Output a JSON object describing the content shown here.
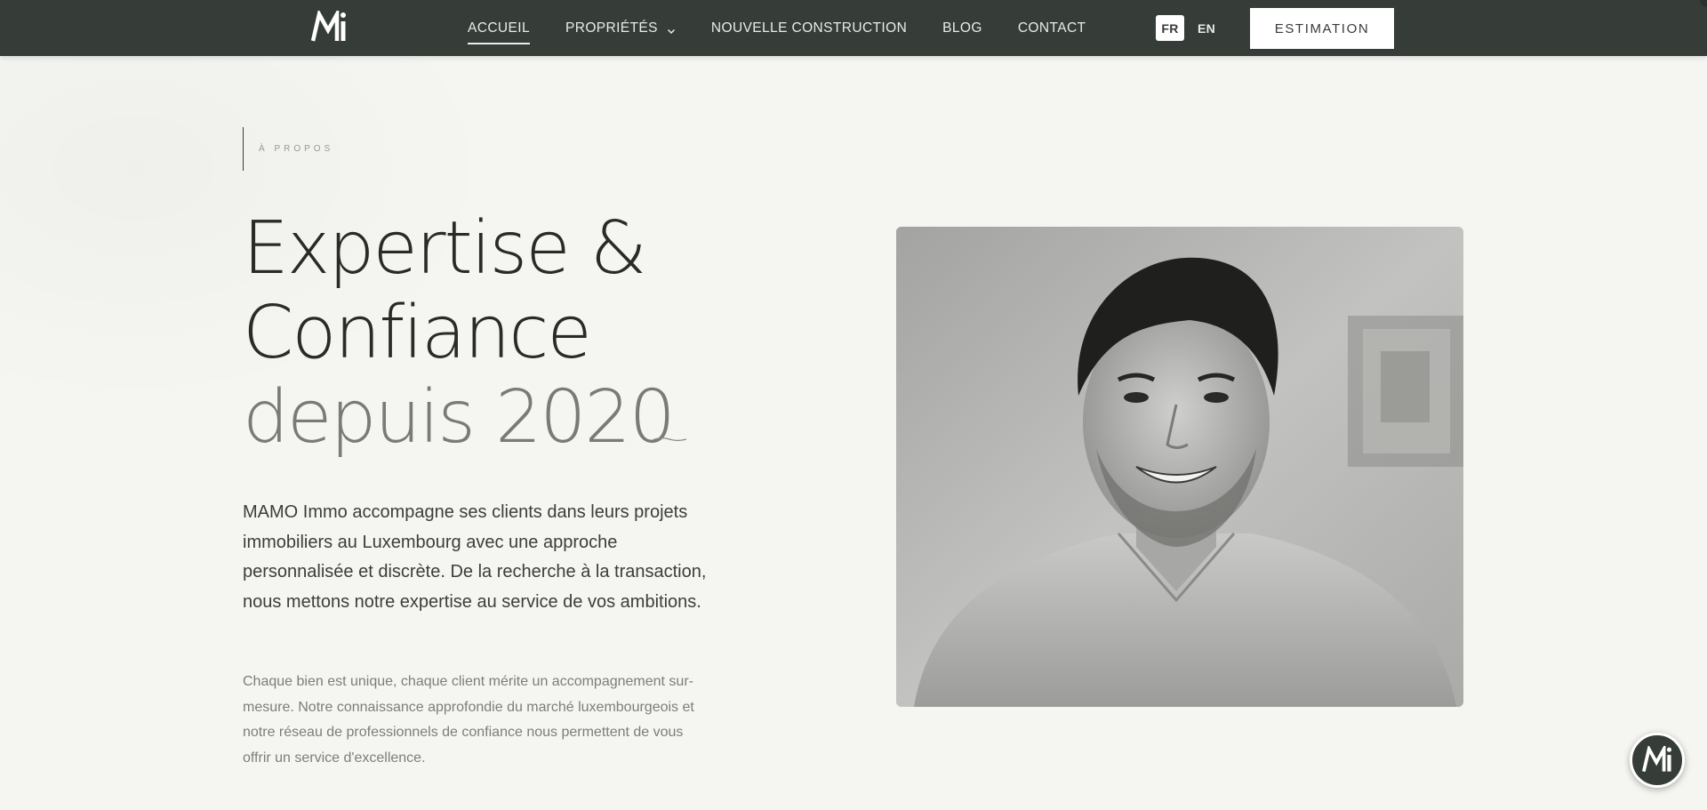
{
  "nav": {
    "logo_icon": "mi-monogram-logo",
    "items": [
      {
        "label": "ACCUEIL",
        "active": true
      },
      {
        "label": "PROPRIÉTÉS",
        "has_dropdown": true
      },
      {
        "label": "NOUVELLE CONSTRUCTION"
      },
      {
        "label": "BLOG"
      },
      {
        "label": "CONTACT"
      }
    ],
    "lang_fr": "FR",
    "lang_en": "EN",
    "cta": "ESTIMATION"
  },
  "about": {
    "eyebrow": "À PROPOS",
    "heading_line1": "Expertise &",
    "heading_line2": "Confiance",
    "heading_line3": "depuis 2020",
    "paragraph1": "MAMO Immo accompagne ses clients dans leurs projets immobiliers au Luxembourg avec une approche personnalisée et discrète. De la recherche à la transaction, nous mettons notre expertise au service de vos ambitions.",
    "paragraph2": "Chaque bien est unique, chaque client mérite un accompagnement sur-mesure. Notre connaissance approfondie du marché luxembourgeois et notre réseau de professionnels de confiance nous permettent de vous offrir un service d'excellence."
  },
  "colors": {
    "nav_bg": "#363d38",
    "page_bg": "#f5f5f1",
    "heading_dark": "#2a2a28",
    "heading_muted": "#7a7a76"
  }
}
